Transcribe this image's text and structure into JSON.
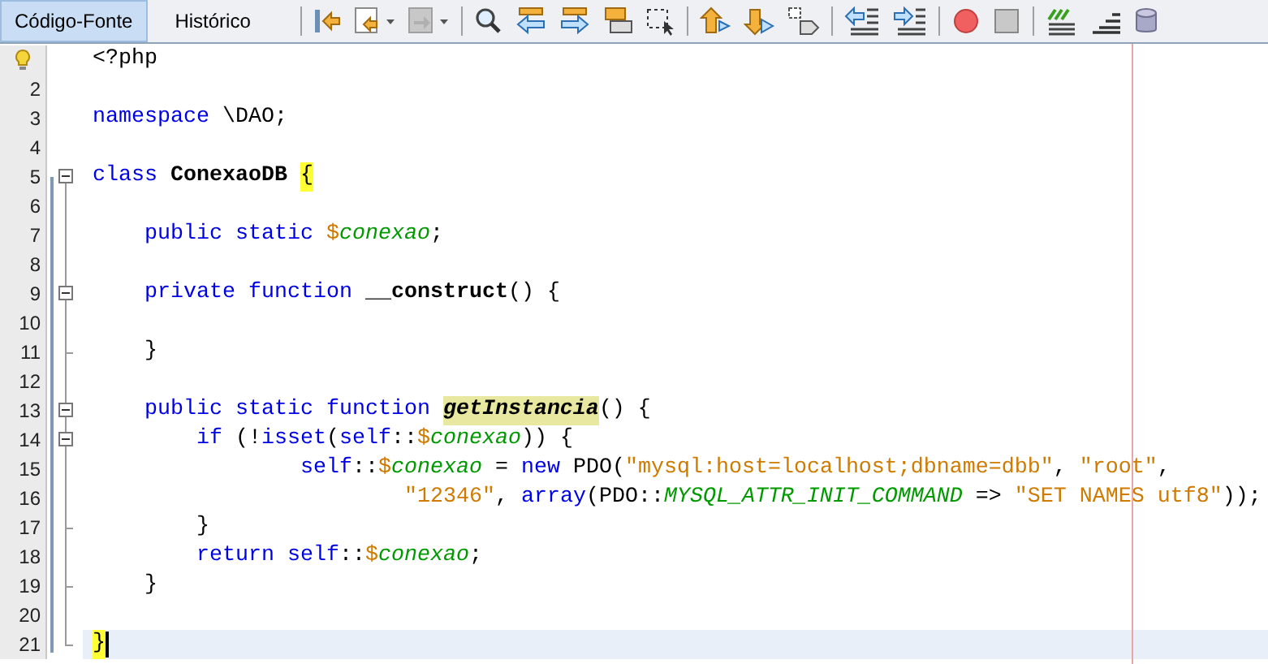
{
  "tabs": [
    {
      "label": "Código-Fonte",
      "selected": true
    },
    {
      "label": "Histórico",
      "selected": false
    }
  ],
  "lines": [
    {
      "hint": true,
      "fold_open": false,
      "fold_close": false,
      "current": false,
      "tokens": [
        {
          "kind": "plain",
          "text": "<?php"
        }
      ]
    },
    {
      "number": "2",
      "fold_open": false,
      "fold_close": false,
      "current": false
    },
    {
      "number": "3",
      "fold_open": false,
      "fold_close": false,
      "current": false,
      "tokens": [
        {
          "kind": "keyword",
          "text": "namespace"
        },
        {
          "kind": "plain",
          "text": " \\DAO;"
        }
      ]
    },
    {
      "number": "4",
      "fold_open": false,
      "fold_close": false,
      "current": false
    },
    {
      "number": "5",
      "fold_open": true,
      "fold_close": false,
      "current": false,
      "tokens": [
        {
          "kind": "keyword",
          "text": "class"
        },
        {
          "kind": "bold",
          "text": " ConexaoDB "
        },
        {
          "kind": "match",
          "text": "{"
        }
      ]
    },
    {
      "number": "6",
      "fold_open": false,
      "fold_close": false,
      "current": false
    },
    {
      "number": "7",
      "fold_open": false,
      "fold_close": false,
      "current": false,
      "tokens": [
        {
          "kind": "keyword",
          "text": "    public static"
        },
        {
          "kind": "sigil",
          "text": " $"
        },
        {
          "kind": "variable",
          "text": "conexao"
        },
        {
          "kind": "plain",
          "text": ";"
        }
      ]
    },
    {
      "number": "8",
      "fold_open": false,
      "fold_close": false,
      "current": false
    },
    {
      "number": "9",
      "fold_open": true,
      "fold_close": false,
      "current": false,
      "tokens": [
        {
          "kind": "keyword",
          "text": "    private function"
        },
        {
          "kind": "bold",
          "text": " __construct"
        },
        {
          "kind": "plain",
          "text": "() {"
        }
      ]
    },
    {
      "number": "10",
      "fold_open": false,
      "fold_close": false,
      "current": false
    },
    {
      "number": "11",
      "fold_open": false,
      "fold_close": true,
      "current": false,
      "tokens": [
        {
          "kind": "plain",
          "text": "    }"
        }
      ]
    },
    {
      "number": "12",
      "fold_open": false,
      "fold_close": false,
      "current": false
    },
    {
      "number": "13",
      "fold_open": true,
      "fold_close": false,
      "current": false,
      "tokens": [
        {
          "kind": "keyword",
          "text": "    public static function "
        },
        {
          "kind": "method",
          "text": "getInstancia"
        },
        {
          "kind": "plain",
          "text": "() {"
        }
      ]
    },
    {
      "number": "14",
      "fold_open": true,
      "fold_close": false,
      "current": false,
      "tokens": [
        {
          "kind": "keyword",
          "text": "        if"
        },
        {
          "kind": "plain",
          "text": " (!"
        },
        {
          "kind": "keyword",
          "text": "isset"
        },
        {
          "kind": "plain",
          "text": "("
        },
        {
          "kind": "keyword",
          "text": "self"
        },
        {
          "kind": "plain",
          "text": "::"
        },
        {
          "kind": "sigil",
          "text": "$"
        },
        {
          "kind": "variable",
          "text": "conexao"
        },
        {
          "kind": "plain",
          "text": ")) {"
        }
      ]
    },
    {
      "number": "15",
      "fold_open": false,
      "fold_close": false,
      "current": false,
      "tokens": [
        {
          "kind": "keyword",
          "text": "                self"
        },
        {
          "kind": "plain",
          "text": "::"
        },
        {
          "kind": "sigil",
          "text": "$"
        },
        {
          "kind": "variable",
          "text": "conexao"
        },
        {
          "kind": "plain",
          "text": " = "
        },
        {
          "kind": "keyword",
          "text": "new"
        },
        {
          "kind": "plain",
          "text": " PDO("
        },
        {
          "kind": "string",
          "text": "\"mysql:host=localhost;dbname=dbb\""
        },
        {
          "kind": "plain",
          "text": ", "
        },
        {
          "kind": "string",
          "text": "\"root\""
        },
        {
          "kind": "plain",
          "text": ","
        }
      ]
    },
    {
      "number": "16",
      "fold_open": false,
      "fold_close": false,
      "current": false,
      "tokens": [
        {
          "kind": "string",
          "text": "                        \"12346\""
        },
        {
          "kind": "plain",
          "text": ", "
        },
        {
          "kind": "keyword",
          "text": "array"
        },
        {
          "kind": "plain",
          "text": "(PDO::"
        },
        {
          "kind": "constant",
          "text": "MYSQL_ATTR_INIT_COMMAND"
        },
        {
          "kind": "plain",
          "text": " => "
        },
        {
          "kind": "string",
          "text": "\"SET NAMES utf8\""
        },
        {
          "kind": "plain",
          "text": "));"
        }
      ]
    },
    {
      "number": "17",
      "fold_open": false,
      "fold_close": true,
      "current": false,
      "tokens": [
        {
          "kind": "plain",
          "text": "        }"
        }
      ]
    },
    {
      "number": "18",
      "fold_open": false,
      "fold_close": false,
      "current": false,
      "tokens": [
        {
          "kind": "keyword",
          "text": "        return self"
        },
        {
          "kind": "plain",
          "text": "::"
        },
        {
          "kind": "sigil",
          "text": "$"
        },
        {
          "kind": "variable",
          "text": "conexao"
        },
        {
          "kind": "plain",
          "text": ";"
        }
      ]
    },
    {
      "number": "19",
      "fold_open": false,
      "fold_close": true,
      "current": false,
      "tokens": [
        {
          "kind": "plain",
          "text": "    }"
        }
      ]
    },
    {
      "number": "20",
      "fold_open": false,
      "fold_close": false,
      "current": false
    },
    {
      "number": "21",
      "fold_open": false,
      "fold_close": true,
      "current": true,
      "tokens": [
        {
          "kind": "match",
          "text": "}"
        }
      ]
    }
  ]
}
